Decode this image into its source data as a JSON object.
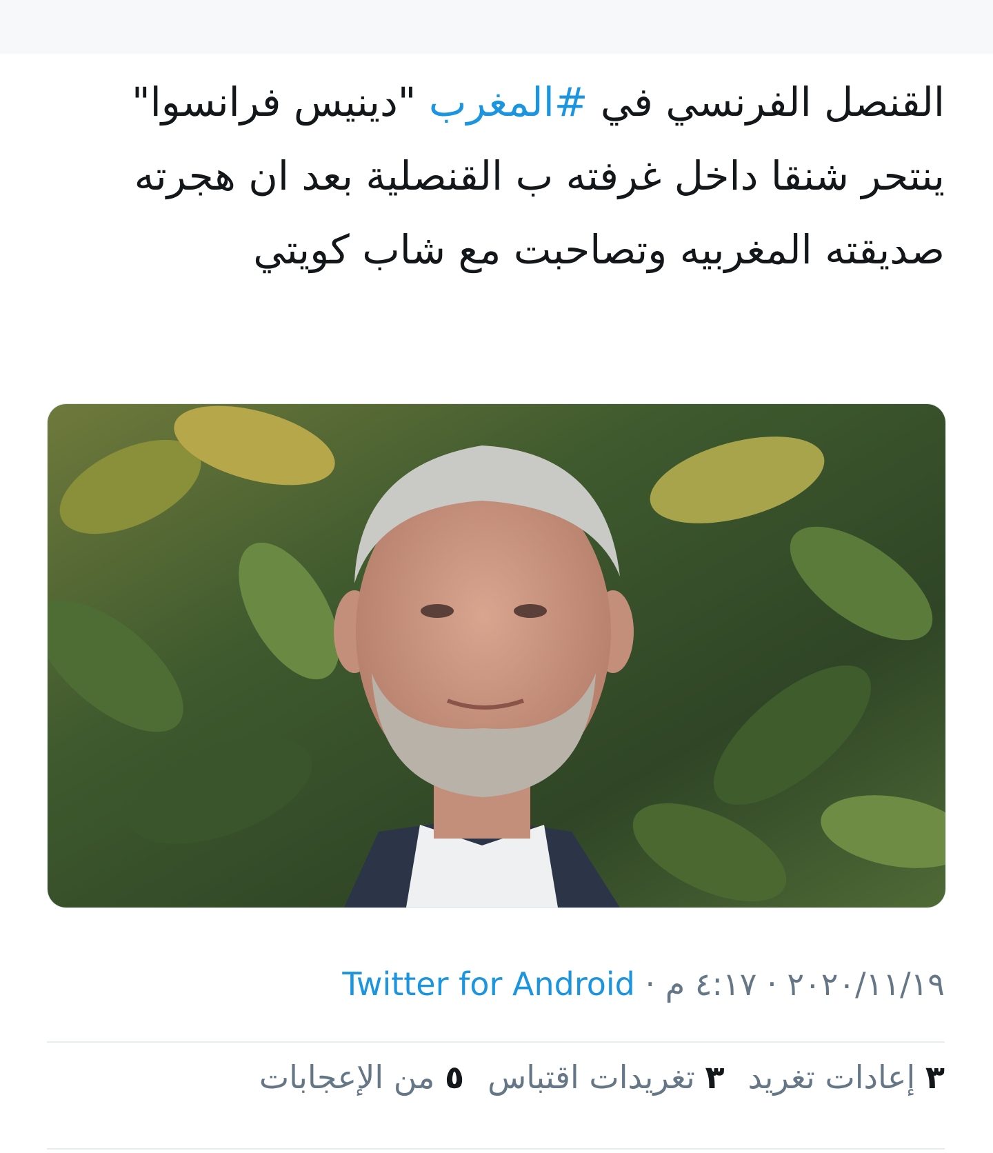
{
  "tweet": {
    "text_before_hashtag": "القنصل الفرنسي في ",
    "hashtag": "#المغرب",
    "text_after_hashtag": " \"دينيس فرانسوا\" ينتحر شنقا داخل غرفته ب القنصلية بعد ان هجرته صديقته المغربيه وتصاحبت مع شاب كويتي"
  },
  "media": {
    "description_icon": "photo-of-man-icon"
  },
  "meta": {
    "date": "٢٠٢٠/١١/١٩",
    "separator": "·",
    "time": "٤:١٧ م",
    "source": "Twitter for Android"
  },
  "stats": {
    "retweets_count": "٣",
    "retweets_label": "إعادات تغريد",
    "quotes_count": "٣",
    "quotes_label": "تغريدات اقتباس",
    "likes_count": "٥",
    "likes_label": "من الإعجابات"
  },
  "colors": {
    "link": "#1b95e0",
    "text": "#14171a",
    "muted": "#657786",
    "divider": "#e6ecf0"
  }
}
